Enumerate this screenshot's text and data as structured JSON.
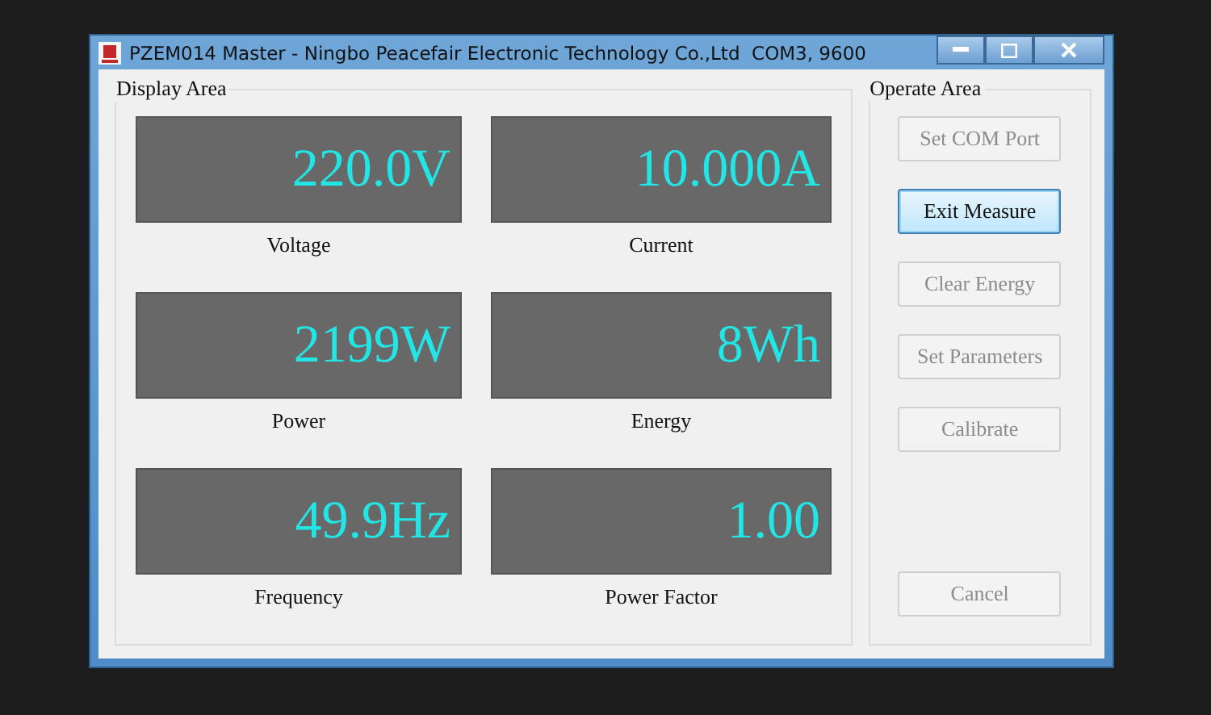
{
  "window": {
    "title": "PZEM014 Master - Ningbo Peacefair Electronic Technology Co.,Ltd  COM3, 9600"
  },
  "display_area": {
    "title": "Display Area",
    "readings": [
      {
        "value": "220.0V",
        "label": "Voltage"
      },
      {
        "value": "10.000A",
        "label": "Current"
      },
      {
        "value": "2199W",
        "label": "Power"
      },
      {
        "value": "8Wh",
        "label": "Energy"
      },
      {
        "value": "49.9Hz",
        "label": "Frequency"
      },
      {
        "value": "1.00",
        "label": "Power Factor"
      }
    ]
  },
  "operate_area": {
    "title": "Operate Area",
    "buttons": [
      {
        "label": "Set COM Port",
        "disabled": true,
        "focused": false
      },
      {
        "label": "Exit Measure",
        "disabled": false,
        "focused": true
      },
      {
        "label": "Clear Energy",
        "disabled": true,
        "focused": false
      },
      {
        "label": "Set Parameters",
        "disabled": true,
        "focused": false
      },
      {
        "label": "Calibrate",
        "disabled": true,
        "focused": false
      }
    ],
    "cancel": {
      "label": "Cancel",
      "disabled": true,
      "focused": false
    }
  }
}
